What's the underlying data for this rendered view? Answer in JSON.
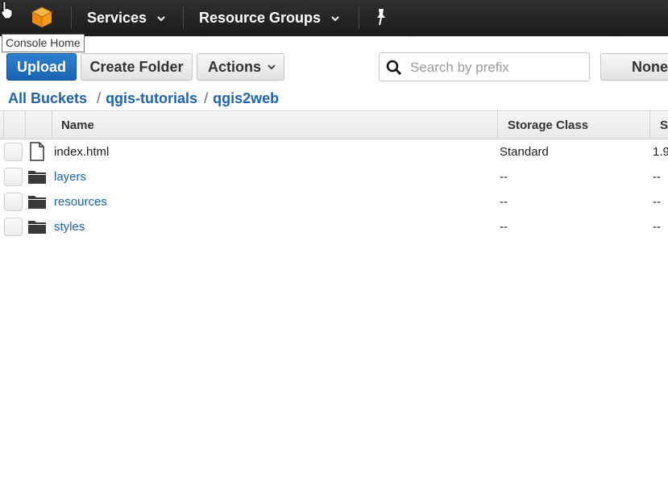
{
  "nav": {
    "logo_icon": "aws-cube-icon",
    "services_label": "Services",
    "resource_groups_label": "Resource Groups",
    "pin_icon": "pin-icon",
    "tooltip": "Console Home"
  },
  "toolbar": {
    "upload_label": "Upload",
    "create_folder_label": "Create Folder",
    "actions_label": "Actions",
    "search_placeholder": "Search by prefix",
    "search_value": "",
    "none_label": "None"
  },
  "breadcrumb": {
    "items": [
      "All Buckets",
      "qgis-tutorials",
      "qgis2web"
    ],
    "separator": "/"
  },
  "table": {
    "columns": [
      "Name",
      "Storage Class",
      "S"
    ],
    "rows": [
      {
        "icon": "file-icon",
        "name": "index.html",
        "is_folder": false,
        "storage_class": "Standard",
        "size": "1.9"
      },
      {
        "icon": "folder-icon",
        "name": "layers",
        "is_folder": true,
        "storage_class": "--",
        "size": "--"
      },
      {
        "icon": "folder-icon",
        "name": "resources",
        "is_folder": true,
        "storage_class": "--",
        "size": "--"
      },
      {
        "icon": "folder-icon",
        "name": "styles",
        "is_folder": true,
        "storage_class": "--",
        "size": "--"
      }
    ]
  },
  "colors": {
    "nav_bg": "#232323",
    "primary_button": "#1f6dc2",
    "link": "#1e63ad",
    "logo_orange": "#f29b1d"
  }
}
